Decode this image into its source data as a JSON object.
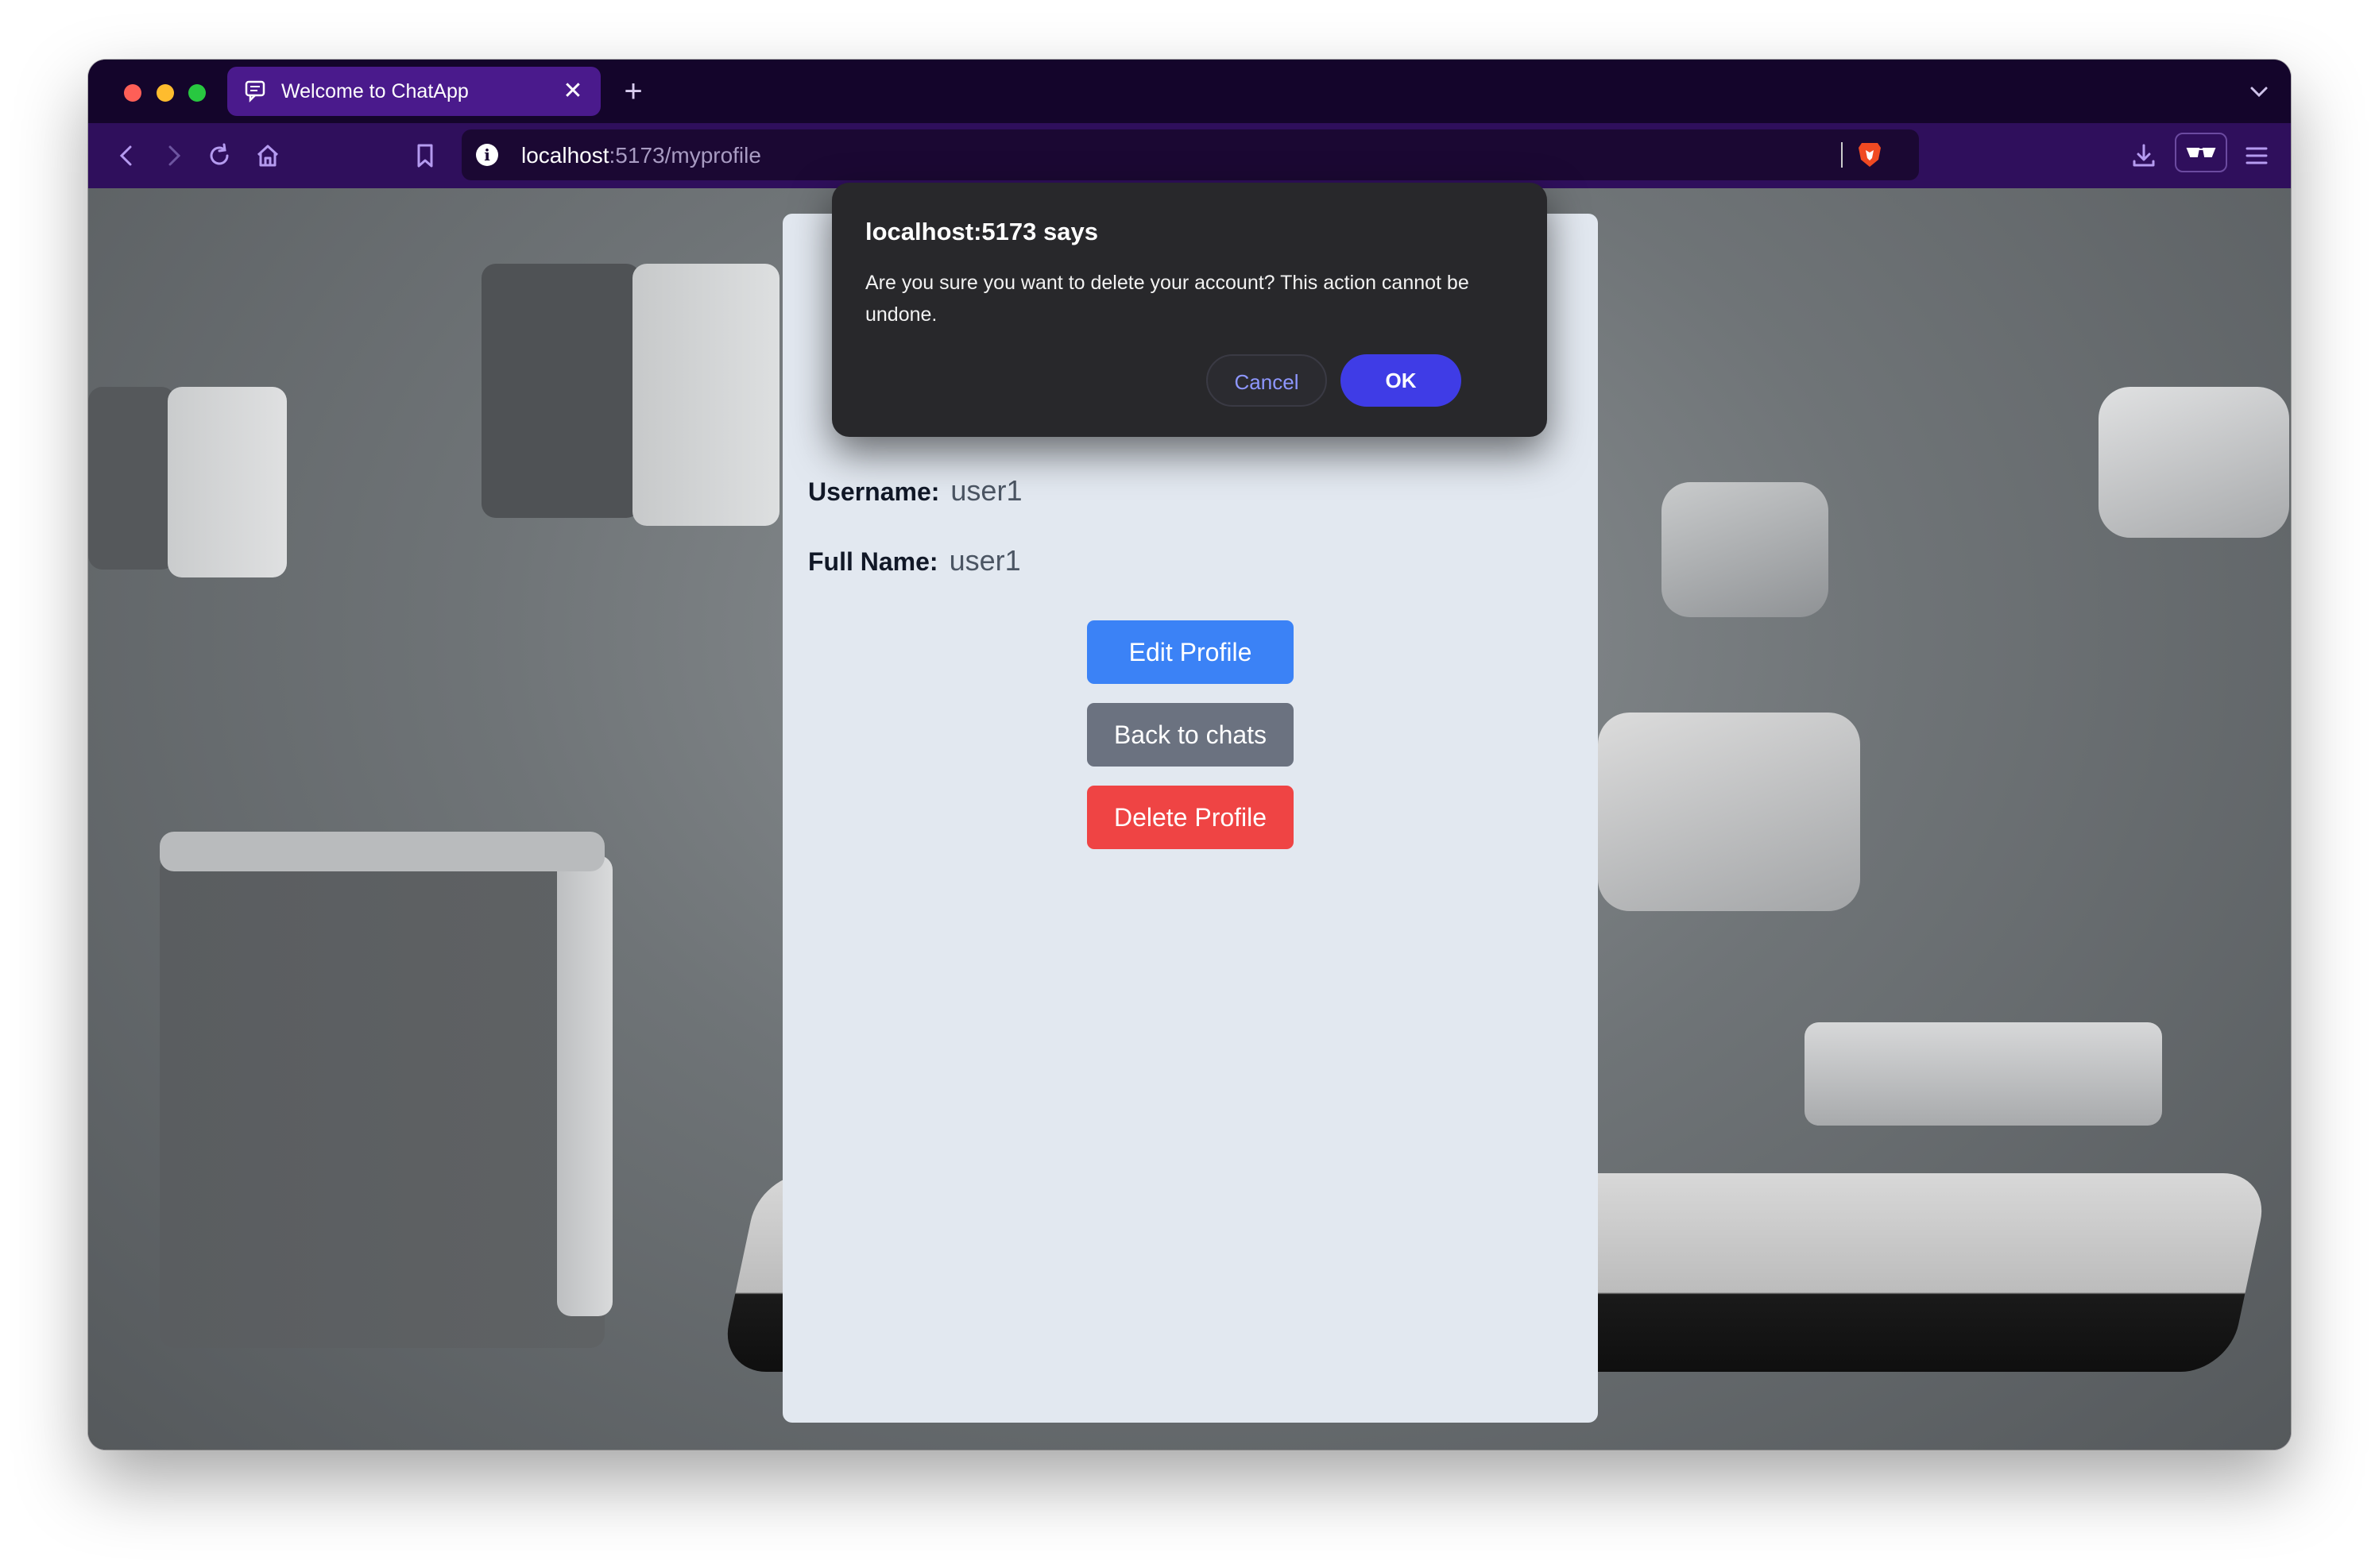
{
  "browser": {
    "tab_title": "Welcome to ChatApp",
    "tab_close": "✕",
    "new_tab": "+",
    "url_host": "localhost",
    "url_path": ":5173/myprofile",
    "info_icon": "i"
  },
  "profile": {
    "username_label": "Username:",
    "username_value": "user1",
    "fullname_label": "Full Name:",
    "fullname_value": "user1",
    "edit_button": "Edit Profile",
    "back_button": "Back to chats",
    "delete_button": "Delete Profile"
  },
  "dialog": {
    "title": "localhost:5173 says",
    "message": "Are you sure you want to delete your account? This action cannot be undone.",
    "cancel_label": "Cancel",
    "ok_label": "OK"
  },
  "colors": {
    "tab_strip": "#14052b",
    "toolbar": "#2f0f5c",
    "edit_button": "#3b82f6",
    "back_button": "#6b7280",
    "delete_button": "#ef4444",
    "dialog_ok": "#3f3ce6"
  }
}
